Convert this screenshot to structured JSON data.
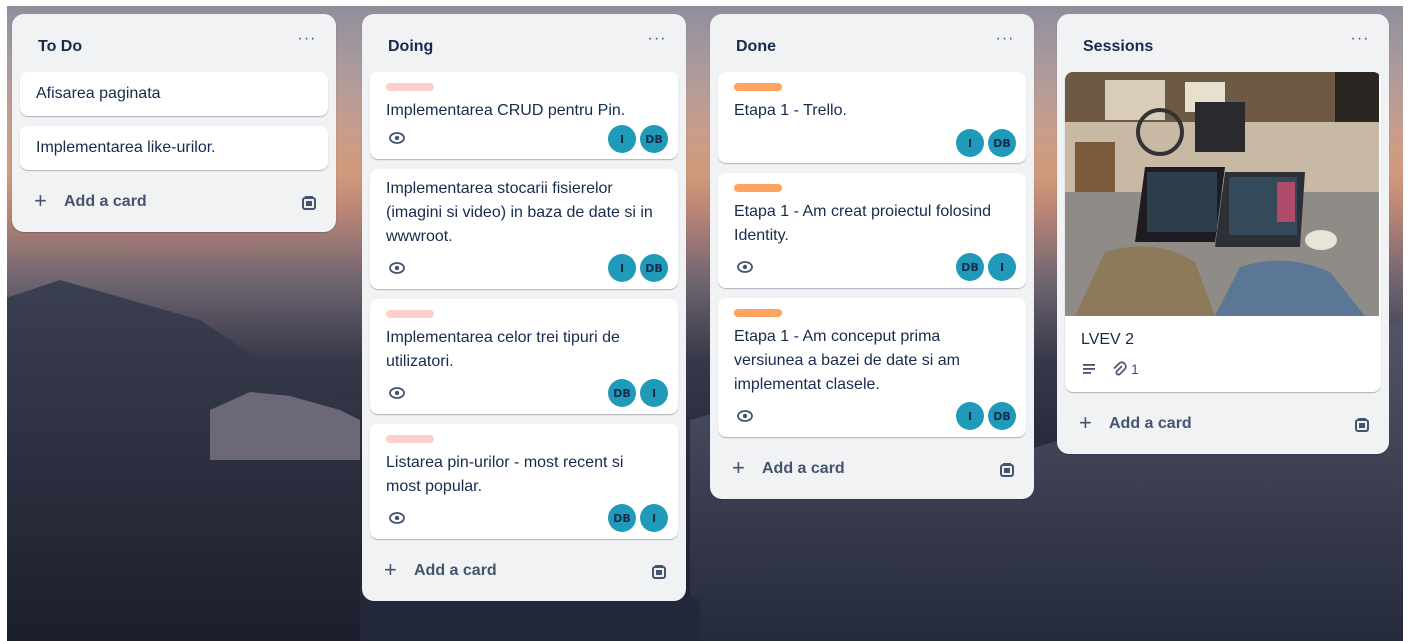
{
  "lists": [
    {
      "title": "To Do",
      "menu": "···",
      "cards": [
        {
          "title": "Afisarea paginata"
        },
        {
          "title": "Implementarea like-urilor."
        }
      ],
      "add_card": "Add a card"
    },
    {
      "title": "Doing",
      "menu": "···",
      "cards": [
        {
          "title": "Implementarea CRUD pentru Pin.",
          "label_color": "#fdd0ce",
          "members": [
            "I",
            "DB"
          ]
        },
        {
          "title": "Implementarea stocarii fisierelor (imagini si video) in baza de date si in wwwroot.",
          "members": [
            "I",
            "DB"
          ]
        },
        {
          "title": "Implementarea celor trei tipuri de utilizatori.",
          "label_color": "#fdd0ce",
          "members": [
            "DB",
            "I"
          ]
        },
        {
          "title": "Listarea pin-urilor - most recent si most popular.",
          "label_color": "#fdd0ce",
          "members": [
            "DB",
            "I"
          ]
        }
      ],
      "add_card": "Add a card"
    },
    {
      "title": "Done",
      "menu": "···",
      "cards": [
        {
          "title": "Etapa 1 - Trello.",
          "label_color": "#fea362",
          "members": [
            "I",
            "DB"
          ]
        },
        {
          "title": "Etapa 1 - Am creat proiectul folosind Identity.",
          "label_color": "#fea362",
          "members": [
            "DB",
            "I"
          ]
        },
        {
          "title": "Etapa 1 - Am conceput prima versiunea a bazei de date si am implementat clasele.",
          "label_color": "#fea362",
          "members": [
            "I",
            "DB"
          ]
        }
      ],
      "add_card": "Add a card"
    },
    {
      "title": "Sessions",
      "menu": "···",
      "cards": [
        {
          "title": "LVEV 2",
          "attachments": "1"
        }
      ],
      "add_card": "Add a card"
    }
  ],
  "colors": {
    "avatar": "#1f9ab8",
    "label_doing": "#fdd0ce",
    "label_done": "#fea362",
    "list_bg": "#f1f2f4",
    "text": "#172b4d"
  },
  "icons": {
    "menu": "ellipsis-icon",
    "watch": "eye-icon",
    "add": "plus-icon",
    "template": "card-template-icon",
    "description": "description-icon",
    "attachment": "paperclip-icon"
  }
}
